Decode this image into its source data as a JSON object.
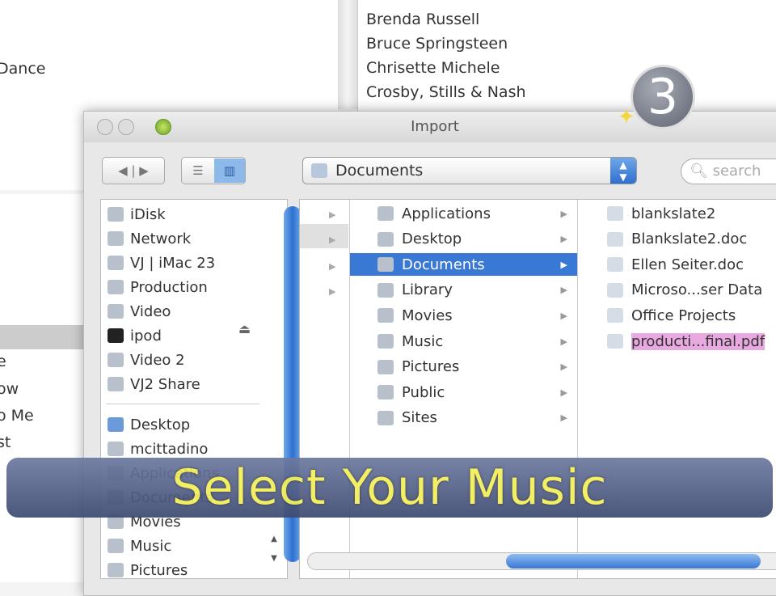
{
  "background": {
    "left_text": "Dance",
    "artists": [
      "Brenda Russell",
      "Bruce Springsteen",
      "Chrisette Michele",
      "Crosby, Stills & Nash"
    ],
    "list": [
      "e",
      "ow",
      "o Me",
      "st"
    ]
  },
  "dialog": {
    "title": "Import",
    "location": "Documents",
    "search_placeholder": "search",
    "sidebar": {
      "devices": [
        {
          "label": "iDisk",
          "icon": "idisk-icon"
        },
        {
          "label": "Network",
          "icon": "network-icon"
        },
        {
          "label": "VJ | iMac 23",
          "icon": "computer-icon"
        },
        {
          "label": "Production",
          "icon": "server-icon"
        },
        {
          "label": "Video",
          "icon": "server-icon"
        },
        {
          "label": "ipod",
          "icon": "ipod-icon"
        },
        {
          "label": "Video 2",
          "icon": "server-icon"
        },
        {
          "label": "VJ2 Share",
          "icon": "server-icon"
        }
      ],
      "places": [
        {
          "label": "Desktop",
          "icon": "desktop-icon"
        },
        {
          "label": "mcittadino",
          "icon": "home-icon"
        },
        {
          "label": "Applications",
          "icon": "applications-icon"
        },
        {
          "label": "Documents",
          "icon": "folder-icon"
        },
        {
          "label": "Movies",
          "icon": "movies-icon"
        },
        {
          "label": "Music",
          "icon": "music-icon"
        },
        {
          "label": "Pictures",
          "icon": "pictures-icon"
        }
      ]
    },
    "column2": [
      "Applications",
      "Desktop",
      "Documents",
      "Library",
      "Movies",
      "Music",
      "Pictures",
      "Public",
      "Sites"
    ],
    "column2_selected": "Documents",
    "column3": [
      "blankslate2",
      "Blankslate2.doc",
      "Ellen Seiter.doc",
      "Microso...ser Data",
      "Office Projects",
      "producti...final.pdf"
    ]
  },
  "overlay": {
    "caption": "Select Your Music",
    "step": "3"
  },
  "colors": {
    "selection": "#3a78d6",
    "caption": "#f2ee5a",
    "banner": "#4e5a82"
  }
}
